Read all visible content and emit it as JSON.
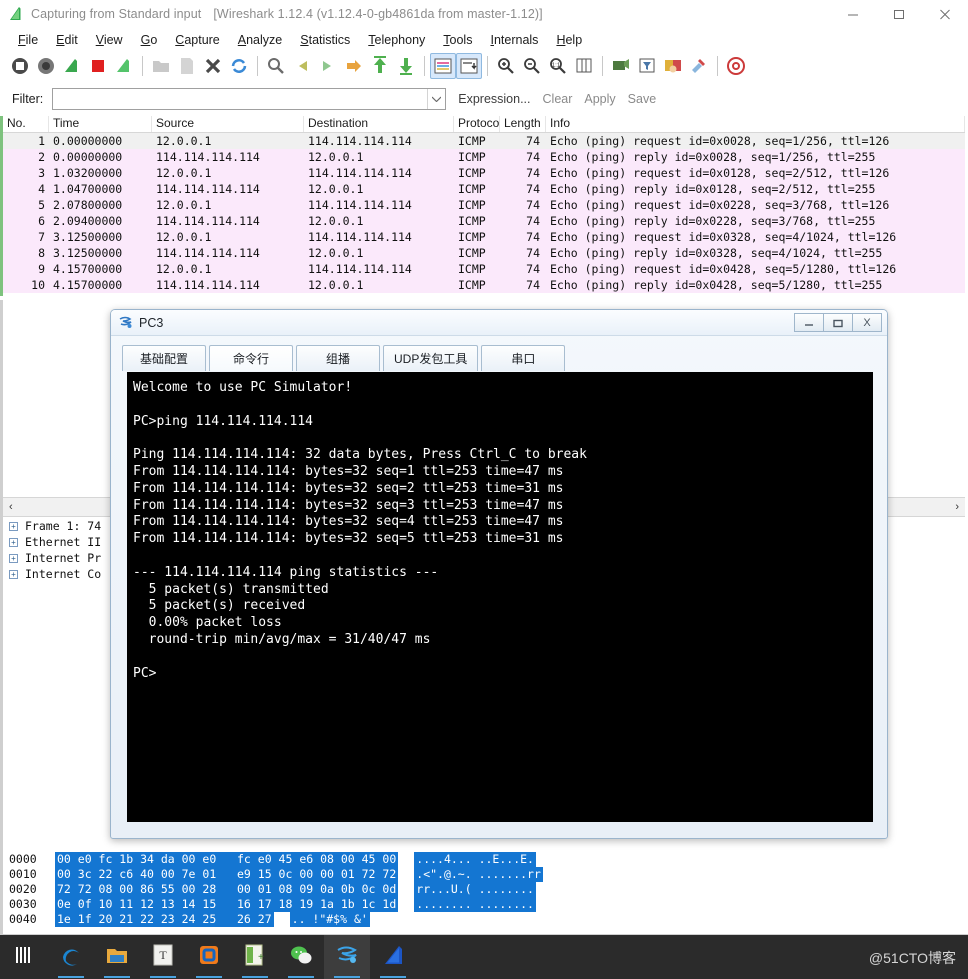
{
  "wireshark": {
    "title": "Capturing from Standard input",
    "title_sub": "[Wireshark 1.12.4  (v1.12.4-0-gb4861da from master-1.12)]",
    "title_icon": "wireshark-fin-icon",
    "window_controls": [
      {
        "name": "minimize-button",
        "glyph": "—"
      },
      {
        "name": "maximize-button",
        "glyph": "□"
      },
      {
        "name": "close-button",
        "glyph": "✕"
      }
    ],
    "menu": [
      "File",
      "Edit",
      "View",
      "Go",
      "Capture",
      "Analyze",
      "Statistics",
      "Telephony",
      "Tools",
      "Internals",
      "Help"
    ],
    "toolbar_icons": [
      "list-interfaces-icon",
      "capture-options-icon",
      "start-capture-icon",
      "stop-capture-icon",
      "restart-capture-icon",
      "sep",
      "open-file-icon",
      "save-file-icon",
      "close-file-icon",
      "reload-icon",
      "sep",
      "find-packet-icon",
      "go-back-icon",
      "go-forward-icon",
      "go-to-packet-icon",
      "go-first-packet-icon",
      "go-last-packet-icon",
      "sep",
      "colorize-icon",
      "auto-scroll-icon",
      "sep",
      "zoom-in-icon",
      "zoom-out-icon",
      "zoom-reset-icon",
      "resize-columns-icon",
      "sep",
      "capture-filters-icon",
      "display-filters-icon",
      "coloring-rules-icon",
      "preferences-icon",
      "sep",
      "help-icon"
    ],
    "filter": {
      "label": "Filter:",
      "value": "",
      "placeholder": "",
      "dropdown_icon": "chevron-down-icon",
      "expression_label": "Expression...",
      "clear_label": "Clear",
      "apply_label": "Apply",
      "save_label": "Save"
    },
    "packet_columns": [
      "No.",
      "Time",
      "Source",
      "Destination",
      "Protocol",
      "Length",
      "Info"
    ],
    "packets": [
      {
        "no": "1",
        "time": "0.00000000",
        "src": "12.0.0.1",
        "dst": "114.114.114.114",
        "proto": "ICMP",
        "len": "74",
        "info": "Echo (ping) request  id=0x0028, seq=1/256, ttl=126",
        "selected": true
      },
      {
        "no": "2",
        "time": "0.00000000",
        "src": "114.114.114.114",
        "dst": "12.0.0.1",
        "proto": "ICMP",
        "len": "74",
        "info": "Echo (ping) reply    id=0x0028, seq=1/256, ttl=255",
        "selected": false
      },
      {
        "no": "3",
        "time": "1.03200000",
        "src": "12.0.0.1",
        "dst": "114.114.114.114",
        "proto": "ICMP",
        "len": "74",
        "info": "Echo (ping) request  id=0x0128, seq=2/512, ttl=126",
        "selected": false
      },
      {
        "no": "4",
        "time": "1.04700000",
        "src": "114.114.114.114",
        "dst": "12.0.0.1",
        "proto": "ICMP",
        "len": "74",
        "info": "Echo (ping) reply    id=0x0128, seq=2/512, ttl=255",
        "selected": false
      },
      {
        "no": "5",
        "time": "2.07800000",
        "src": "12.0.0.1",
        "dst": "114.114.114.114",
        "proto": "ICMP",
        "len": "74",
        "info": "Echo (ping) request  id=0x0228, seq=3/768, ttl=126",
        "selected": false
      },
      {
        "no": "6",
        "time": "2.09400000",
        "src": "114.114.114.114",
        "dst": "12.0.0.1",
        "proto": "ICMP",
        "len": "74",
        "info": "Echo (ping) reply    id=0x0228, seq=3/768, ttl=255",
        "selected": false
      },
      {
        "no": "7",
        "time": "3.12500000",
        "src": "12.0.0.1",
        "dst": "114.114.114.114",
        "proto": "ICMP",
        "len": "74",
        "info": "Echo (ping) request  id=0x0328, seq=4/1024, ttl=126",
        "selected": false
      },
      {
        "no": "8",
        "time": "3.12500000",
        "src": "114.114.114.114",
        "dst": "12.0.0.1",
        "proto": "ICMP",
        "len": "74",
        "info": "Echo (ping) reply    id=0x0328, seq=4/1024, ttl=255",
        "selected": false
      },
      {
        "no": "9",
        "time": "4.15700000",
        "src": "12.0.0.1",
        "dst": "114.114.114.114",
        "proto": "ICMP",
        "len": "74",
        "info": "Echo (ping) request  id=0x0428, seq=5/1280, ttl=126",
        "selected": false
      },
      {
        "no": "10",
        "time": "4.15700000",
        "src": "114.114.114.114",
        "dst": "12.0.0.1",
        "proto": "ICMP",
        "len": "74",
        "info": "Echo (ping) reply    id=0x0428, seq=5/1280, ttl=255",
        "selected": false
      }
    ],
    "detail_tree": [
      {
        "label": "Frame 1: 74",
        "toggle": "+"
      },
      {
        "label": "Ethernet II",
        "toggle": "+"
      },
      {
        "label": "Internet Pr",
        "toggle": "+"
      },
      {
        "label": "Internet Co",
        "toggle": "+"
      }
    ],
    "hex_rows": [
      {
        "offset": "0000",
        "bytes": "00 e0 fc 1b 34 da 00 e0   fc e0 45 e6 08 00 45 00",
        "ascii": "....4... ..E...E."
      },
      {
        "offset": "0010",
        "bytes": "00 3c 22 c6 40 00 7e 01   e9 15 0c 00 00 01 72 72",
        "ascii": ".<\".@.~. .......rr"
      },
      {
        "offset": "0020",
        "bytes": "72 72 08 00 86 55 00 28   00 01 08 09 0a 0b 0c 0d",
        "ascii": "rr...U.( ........"
      },
      {
        "offset": "0030",
        "bytes": "0e 0f 10 11 12 13 14 15   16 17 18 19 1a 1b 1c 1d",
        "ascii": "........ ........"
      },
      {
        "offset": "0040",
        "bytes": "1e 1f 20 21 22 23 24 25   26 27",
        "ascii": ".. !\"#$% &'"
      }
    ]
  },
  "pc3": {
    "title": "PC3",
    "title_icon": "pc-simulator-icon",
    "window_controls": [
      {
        "name": "minimize-button",
        "glyph": "—"
      },
      {
        "name": "maximize-button",
        "glyph": "▭"
      },
      {
        "name": "close-button",
        "glyph": "X"
      }
    ],
    "tabs": [
      {
        "label": "基础配置",
        "active": false
      },
      {
        "label": "命令行",
        "active": true
      },
      {
        "label": "组播",
        "active": false
      },
      {
        "label": "UDP发包工具",
        "active": false
      },
      {
        "label": "串口",
        "active": false
      }
    ],
    "terminal_text": "Welcome to use PC Simulator!\n\nPC>ping 114.114.114.114\n\nPing 114.114.114.114: 32 data bytes, Press Ctrl_C to break\nFrom 114.114.114.114: bytes=32 seq=1 ttl=253 time=47 ms\nFrom 114.114.114.114: bytes=32 seq=2 ttl=253 time=31 ms\nFrom 114.114.114.114: bytes=32 seq=3 ttl=253 time=47 ms\nFrom 114.114.114.114: bytes=32 seq=4 ttl=253 time=47 ms\nFrom 114.114.114.114: bytes=32 seq=5 ttl=253 time=31 ms\n\n--- 114.114.114.114 ping statistics ---\n  5 packet(s) transmitted\n  5 packet(s) received\n  0.00% packet loss\n  round-trip min/avg/max = 31/40/47 ms\n\nPC>"
  },
  "taskbar": {
    "items": [
      {
        "name": "start-button-icon",
        "selected": false,
        "running": false
      },
      {
        "name": "edge-browser-icon",
        "selected": false,
        "running": true
      },
      {
        "name": "file-explorer-icon",
        "selected": false,
        "running": true
      },
      {
        "name": "text-editor-icon",
        "selected": false,
        "running": true
      },
      {
        "name": "office-app-icon",
        "selected": false,
        "running": true
      },
      {
        "name": "notepad-plus-icon",
        "selected": false,
        "running": true
      },
      {
        "name": "wechat-icon",
        "selected": false,
        "running": true
      },
      {
        "name": "ensp-simulator-icon",
        "selected": true,
        "running": true
      },
      {
        "name": "wireshark-icon",
        "selected": false,
        "running": true
      }
    ],
    "watermark": "@51CTO博客"
  },
  "colors": {
    "icmp_row": "#fbe9fb",
    "selected_row": "#f0f0f0",
    "hex_highlight": "#1476d2",
    "terminal_bg": "#000000",
    "taskbar_bg": "#2b2b2b",
    "accent_blue": "#4aa3df"
  }
}
